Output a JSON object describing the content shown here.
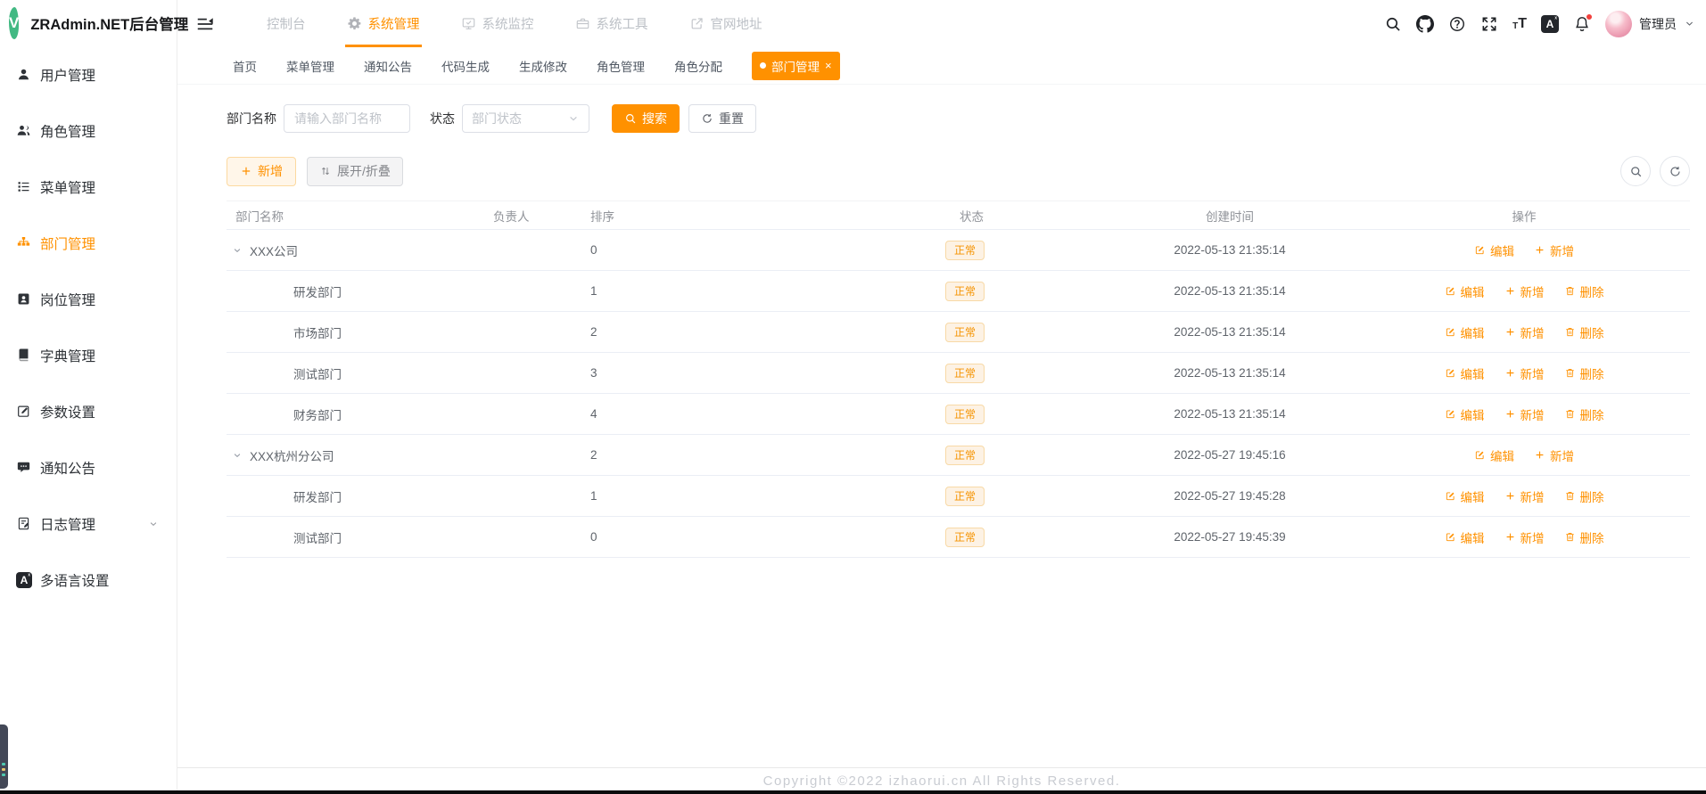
{
  "colors": {
    "accent": "#ff9100",
    "logo_green": "#42b983",
    "status_tag": "#f59300"
  },
  "sidebar": {
    "title": "ZRAdmin.NET后台管理",
    "logo_letter": "V",
    "items": [
      {
        "label": "用户管理"
      },
      {
        "label": "角色管理"
      },
      {
        "label": "菜单管理"
      },
      {
        "label": "部门管理"
      },
      {
        "label": "岗位管理"
      },
      {
        "label": "字典管理"
      },
      {
        "label": "参数设置"
      },
      {
        "label": "通知公告"
      },
      {
        "label": "日志管理"
      },
      {
        "label": "多语言设置"
      }
    ]
  },
  "navbar": {
    "items": [
      {
        "label": "控制台"
      },
      {
        "label": "系统管理"
      },
      {
        "label": "系统监控"
      },
      {
        "label": "系统工具"
      },
      {
        "label": "官网地址"
      }
    ],
    "username": "管理员"
  },
  "tabs": {
    "close_glyph": "×",
    "items": [
      {
        "label": "首页"
      },
      {
        "label": "菜单管理"
      },
      {
        "label": "通知公告"
      },
      {
        "label": "代码生成"
      },
      {
        "label": "生成修改"
      },
      {
        "label": "角色管理"
      },
      {
        "label": "角色分配"
      },
      {
        "label": "部门管理"
      }
    ]
  },
  "filters": {
    "name_label": "部门名称",
    "name_placeholder": "请输入部门名称",
    "status_label": "状态",
    "status_placeholder": "部门状态",
    "search_button": "搜索",
    "reset_button": "重置"
  },
  "toolbar": {
    "add_button": "新增",
    "toggle_button": "展开/折叠"
  },
  "table": {
    "columns": [
      "部门名称",
      "负责人",
      "排序",
      "状态",
      "创建时间",
      "操作"
    ],
    "action_labels": {
      "edit": "编辑",
      "add": "新增",
      "delete": "删除"
    },
    "rows": [
      {
        "name": "XXX公司",
        "leader": "",
        "order": "0",
        "status": "正常",
        "created": "2022-05-13 21:35:14"
      },
      {
        "name": "研发部门",
        "leader": "",
        "order": "1",
        "status": "正常",
        "created": "2022-05-13 21:35:14"
      },
      {
        "name": "市场部门",
        "leader": "",
        "order": "2",
        "status": "正常",
        "created": "2022-05-13 21:35:14"
      },
      {
        "name": "测试部门",
        "leader": "",
        "order": "3",
        "status": "正常",
        "created": "2022-05-13 21:35:14"
      },
      {
        "name": "财务部门",
        "leader": "",
        "order": "4",
        "status": "正常",
        "created": "2022-05-13 21:35:14"
      },
      {
        "name": "XXX杭州分公司",
        "leader": "",
        "order": "2",
        "status": "正常",
        "created": "2022-05-27 19:45:16"
      },
      {
        "name": "研发部门",
        "leader": "",
        "order": "1",
        "status": "正常",
        "created": "2022-05-27 19:45:28"
      },
      {
        "name": "测试部门",
        "leader": "",
        "order": "0",
        "status": "正常",
        "created": "2022-05-27 19:45:39"
      }
    ]
  },
  "footer": {
    "copyright": "Copyright ©2022 izhaorui.cn All Rights Reserved."
  }
}
